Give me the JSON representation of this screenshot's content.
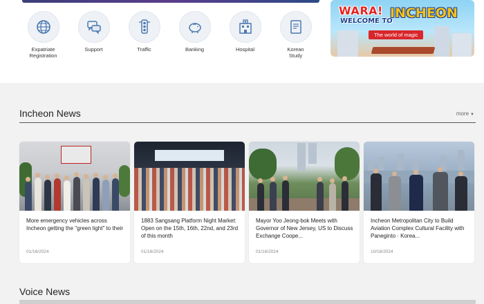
{
  "quick_menu": [
    {
      "label": "Expatriate\nRegistration",
      "icon": "globe-icon"
    },
    {
      "label": "Support",
      "icon": "chat-bubbles-icon"
    },
    {
      "label": "Traffic",
      "icon": "traffic-light-icon"
    },
    {
      "label": "Banking",
      "icon": "piggy-bank-icon"
    },
    {
      "label": "Hospital",
      "icon": "hospital-icon"
    },
    {
      "label": "Korean\nStudy",
      "icon": "book-icon"
    }
  ],
  "banner": {
    "line1": "WARA!",
    "line2": "WELCOME TO",
    "line3": "INCHEON",
    "sub": "The world of magic"
  },
  "news": {
    "title": "Incheon News",
    "more": "more",
    "cards": [
      {
        "title": "More emergency vehicles across Incheon getting the \"green light\" to their",
        "date": "01/16/2024"
      },
      {
        "title": "1883 Sangsang Platform Night Market: Open on the 15th, 16th, 22nd, and 23rd of this month",
        "date": "01/16/2024"
      },
      {
        "title": "Mayor Yoo Jeong-bok Meets with Governor of New Jersey, US to Discuss Exchange Coope...",
        "date": "01/16/2024"
      },
      {
        "title": "Incheon Metropolitan City to Build Aviation Complex Cultural Facility with Paneginto · Korea...",
        "date": "10/16/2024"
      }
    ]
  },
  "voice": {
    "title": "Voice News"
  }
}
